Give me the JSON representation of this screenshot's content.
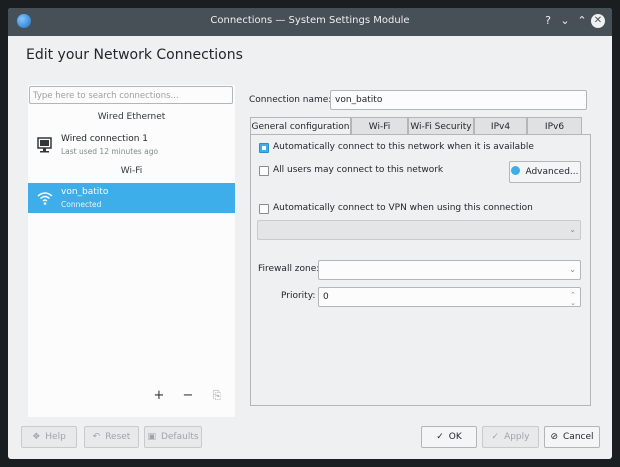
{
  "window": {
    "title": "Connections — System Settings Module",
    "controls": {
      "help": "?",
      "minimize": "⌄",
      "maximize": "⌃",
      "close": "✕"
    }
  },
  "heading": "Edit your Network Connections",
  "sidebar": {
    "search_placeholder": "Type here to search connections...",
    "sections": [
      {
        "title": "Wired Ethernet",
        "items": [
          {
            "name": "Wired connection 1",
            "status": "Last used 12 minutes ago",
            "icon": "wired-network-icon"
          }
        ]
      },
      {
        "title": "Wi-Fi",
        "items": [
          {
            "name": "von_batito",
            "status": "Connected",
            "icon": "wifi-icon",
            "selected": true
          }
        ]
      }
    ],
    "tools": {
      "add": "+",
      "remove": "−",
      "export": "⎘"
    }
  },
  "editor": {
    "connection_name_label": "Connection name:",
    "connection_name_value": "von_batito",
    "tabs": [
      "General configuration",
      "Wi-Fi",
      "Wi-Fi Security",
      "IPv4",
      "IPv6"
    ],
    "active_tab": "General configuration",
    "options": {
      "auto_connect": {
        "label": "Automatically connect to this network when it is available",
        "checked": true
      },
      "all_users": {
        "label": "All users may connect to this network",
        "checked": false
      },
      "advanced_button": "Advanced...",
      "auto_vpn": {
        "label": "Automatically connect to VPN when using this connection",
        "checked": false
      },
      "vpn_select_value": "",
      "firewall_label": "Firewall zone:",
      "firewall_value": "",
      "priority_label": "Priority:",
      "priority_value": "0"
    }
  },
  "footer": {
    "help": "Help",
    "reset": "Reset",
    "defaults": "Defaults",
    "ok": "OK",
    "apply": "Apply",
    "cancel": "Cancel"
  },
  "colors": {
    "accent": "#3daee9",
    "titlebar": "#475057",
    "window_bg": "#eff0f1"
  }
}
